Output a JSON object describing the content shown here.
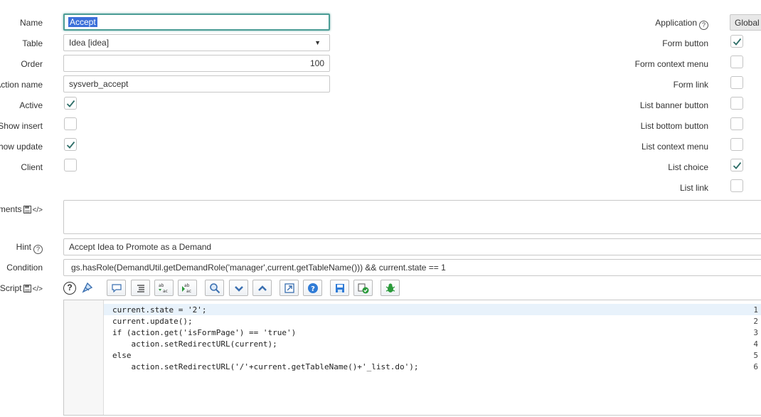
{
  "labels": {
    "name": "Name",
    "table": "Table",
    "order": "Order",
    "action_name": "Action name",
    "active": "Active",
    "show_insert": "Show insert",
    "show_update": "Show update",
    "client": "Client",
    "comments": "Comments",
    "hint": "Hint",
    "condition": "Condition",
    "script": "Script"
  },
  "fields": {
    "name": "Accept",
    "table": "Idea [idea]",
    "order": "100",
    "action_name": "sysverb_accept",
    "comments": "",
    "hint": "Accept Idea to Promote as a Demand",
    "condition": "gs.hasRole(DemandUtil.getDemandRole('manager',current.getTableName())) && current.state == 1"
  },
  "checks_left": {
    "active": true,
    "show_insert": false,
    "show_update": true,
    "client": false
  },
  "right": {
    "application_label": "Application",
    "application_value": "Global",
    "items": [
      {
        "label": "Form button",
        "checked": true
      },
      {
        "label": "Form context menu",
        "checked": false
      },
      {
        "label": "Form link",
        "checked": false
      },
      {
        "label": "List banner button",
        "checked": false
      },
      {
        "label": "List bottom button",
        "checked": false
      },
      {
        "label": "List context menu",
        "checked": false
      },
      {
        "label": "List choice",
        "checked": true
      },
      {
        "label": "List link",
        "checked": false
      }
    ]
  },
  "toolbar_icons": [
    "help-icon",
    "format-code-icon",
    "comment-icon",
    "format-icon",
    "replace-icon",
    "replace-all-icon",
    "search-icon",
    "next-icon",
    "previous-icon",
    "fullscreen-icon",
    "syntax-help-icon",
    "save-icon",
    "validate-icon",
    "debug-icon"
  ],
  "script": {
    "line_numbers": [
      "1",
      "2",
      "3",
      "4",
      "5",
      "6"
    ],
    "lines": [
      "current.state = '2';",
      "current.update();",
      "if (action.get('isFormPage') == 'true')",
      "    action.setRedirectURL(current);",
      "else",
      "    action.setRedirectURL('/'+current.getTableName()+'_list.do');"
    ]
  },
  "colors": {
    "accent": "#4c9d96",
    "check": "#2e6e68",
    "selection": "#3b6fd9"
  }
}
